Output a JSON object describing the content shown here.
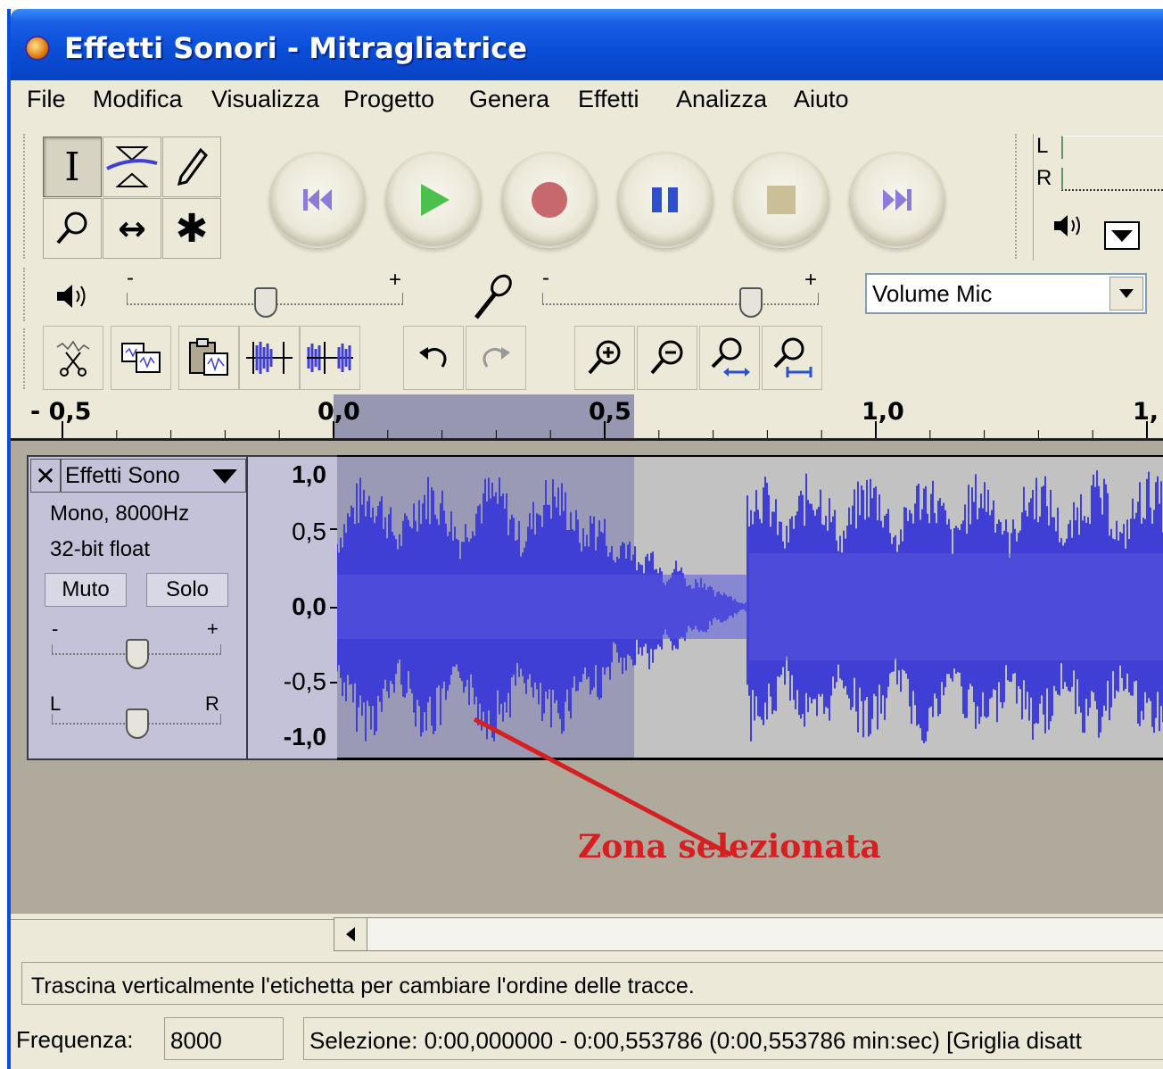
{
  "window": {
    "title": "Effetti Sonori - Mitragliatrice"
  },
  "menu": [
    "File",
    "Modifica",
    "Visualizza",
    "Progetto",
    "Genera",
    "Effetti",
    "Analizza",
    "Aiuto"
  ],
  "tools": {
    "selection": "I",
    "zoom": "",
    "timeshift": "↔",
    "multi": "✱"
  },
  "meters": {
    "left": "L",
    "right": "R"
  },
  "mixer": {
    "minus": "-",
    "plus": "+",
    "output_level": 0.5,
    "input_level": 0.75,
    "input_source": "Volume Mic"
  },
  "ruler": {
    "labels": [
      "- 0,5",
      "0,0",
      "0,5",
      "1,0",
      "1,"
    ],
    "selection_start": 0.0,
    "selection_end": 0.553786
  },
  "track": {
    "name": "Effetti Sono",
    "info_line1": "Mono, 8000Hz",
    "info_line2": "32-bit float",
    "mute_label": "Muto",
    "solo_label": "Solo",
    "gain_minus": "-",
    "gain_plus": "+",
    "pan_left": "L",
    "pan_right": "R",
    "scale": [
      "1,0",
      "0,5",
      "0,0",
      "-0,5",
      "-1,0"
    ]
  },
  "annotation": "Zona selezionata",
  "colors": {
    "titlebar": "#0a4fd8",
    "waveform": "#3f3fd6",
    "selection": "#9a99b6",
    "annotation": "#d42020"
  },
  "status": {
    "message": "Trascina verticalmente l'etichetta per cambiare l'ordine delle tracce.",
    "rate_label": "Frequenza:",
    "rate_value": "8000",
    "selection": "Selezione: 0:00,000000 - 0:00,553786 (0:00,553786 min:sec)  [Griglia disatt"
  }
}
